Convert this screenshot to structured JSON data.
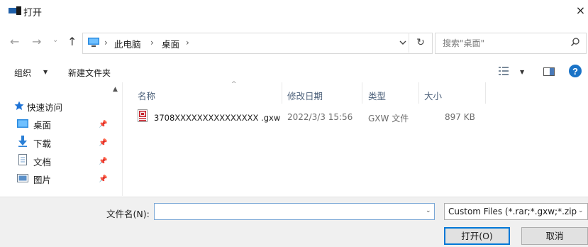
{
  "window": {
    "title": "打开",
    "close_glyph": "×"
  },
  "nav": {
    "back_glyph": "←",
    "forward_glyph": "→",
    "recent_glyph": "⌄",
    "up_glyph": "↑"
  },
  "address": {
    "separator": "›",
    "breadcrumbs": [
      "此电脑",
      "桌面"
    ],
    "dropdown_icon": "chevron-down-icon",
    "refresh_glyph": "↻"
  },
  "search": {
    "placeholder": "搜索\"桌面\""
  },
  "toolbar": {
    "organize_label": "组织",
    "organize_caret": "▼",
    "new_folder_label": "新建文件夹",
    "view_caret": "▼"
  },
  "sidebar": {
    "scroll_glyph": "▲",
    "pin_glyph": "📌",
    "quick_access": "快速访问",
    "items": [
      {
        "label": "桌面",
        "icon": "desktop-icon",
        "pinned": true
      },
      {
        "label": "下载",
        "icon": "download-icon",
        "pinned": true
      },
      {
        "label": "文档",
        "icon": "document-icon",
        "pinned": true
      },
      {
        "label": "图片",
        "icon": "picture-icon",
        "pinned": true
      }
    ]
  },
  "filelist": {
    "sort_glyph": "^",
    "columns": [
      "名称",
      "修改日期",
      "类型",
      "大小"
    ],
    "rows": [
      {
        "name": "3708XXXXXXXXXXXXXXX .gxw",
        "modified": "2022/3/3 15:56",
        "type": "GXW 文件",
        "size": "897 KB"
      }
    ]
  },
  "footer": {
    "filename_label": "文件名(N):",
    "filename_value": "",
    "dropdown_glyph": "⌄",
    "filetype_value": "Custom Files (*.rar;*.gxw;*.zip",
    "open_label": "打开(O)",
    "cancel_label": "取消"
  },
  "colors": {
    "accent": "#0078d7",
    "header_text": "#4c607a",
    "help_blue": "#1a73c7"
  }
}
